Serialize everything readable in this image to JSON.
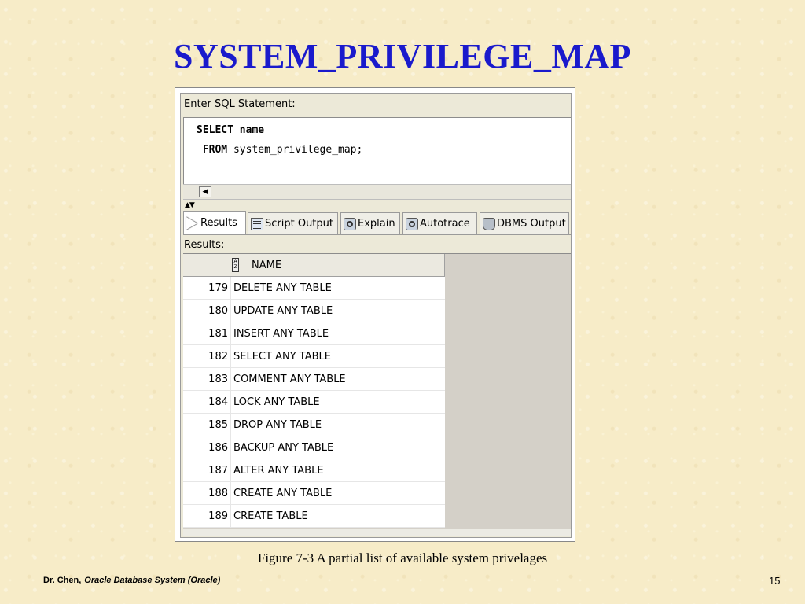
{
  "slide": {
    "title": "SYSTEM_PRIVILEGE_MAP",
    "caption": "Figure 7-3    A partial list of available system privelages",
    "footer_author": "Dr. Chen,",
    "footer_course": "Oracle Database System (Oracle)",
    "page_number": "15"
  },
  "editor": {
    "label": "Enter SQL Statement:",
    "line1_kw": "SELECT",
    "line1_rest": " name",
    "line2_kw": " FROM",
    "line2_rest": " system_privilege_map;"
  },
  "tabs": [
    {
      "label": "Results",
      "icon": "play-icon"
    },
    {
      "label": "Script Output",
      "icon": "script-icon"
    },
    {
      "label": "Explain",
      "icon": "explain-icon"
    },
    {
      "label": "Autotrace",
      "icon": "autotrace-icon"
    },
    {
      "label": "DBMS Output",
      "icon": "dbms-icon"
    }
  ],
  "results": {
    "label": "Results:",
    "column_header": "NAME",
    "rows": [
      {
        "num": "179",
        "name": "DELETE ANY TABLE"
      },
      {
        "num": "180",
        "name": "UPDATE ANY TABLE"
      },
      {
        "num": "181",
        "name": "INSERT ANY TABLE"
      },
      {
        "num": "182",
        "name": "SELECT ANY TABLE"
      },
      {
        "num": "183",
        "name": "COMMENT ANY TABLE"
      },
      {
        "num": "184",
        "name": "LOCK ANY TABLE"
      },
      {
        "num": "185",
        "name": "DROP ANY TABLE"
      },
      {
        "num": "186",
        "name": "BACKUP ANY TABLE"
      },
      {
        "num": "187",
        "name": "ALTER ANY TABLE"
      },
      {
        "num": "188",
        "name": "CREATE ANY TABLE"
      },
      {
        "num": "189",
        "name": "CREATE TABLE"
      }
    ]
  },
  "colors": {
    "title": "#1a1acc",
    "background": "#f7ecc8",
    "window": "#ece9d8"
  }
}
